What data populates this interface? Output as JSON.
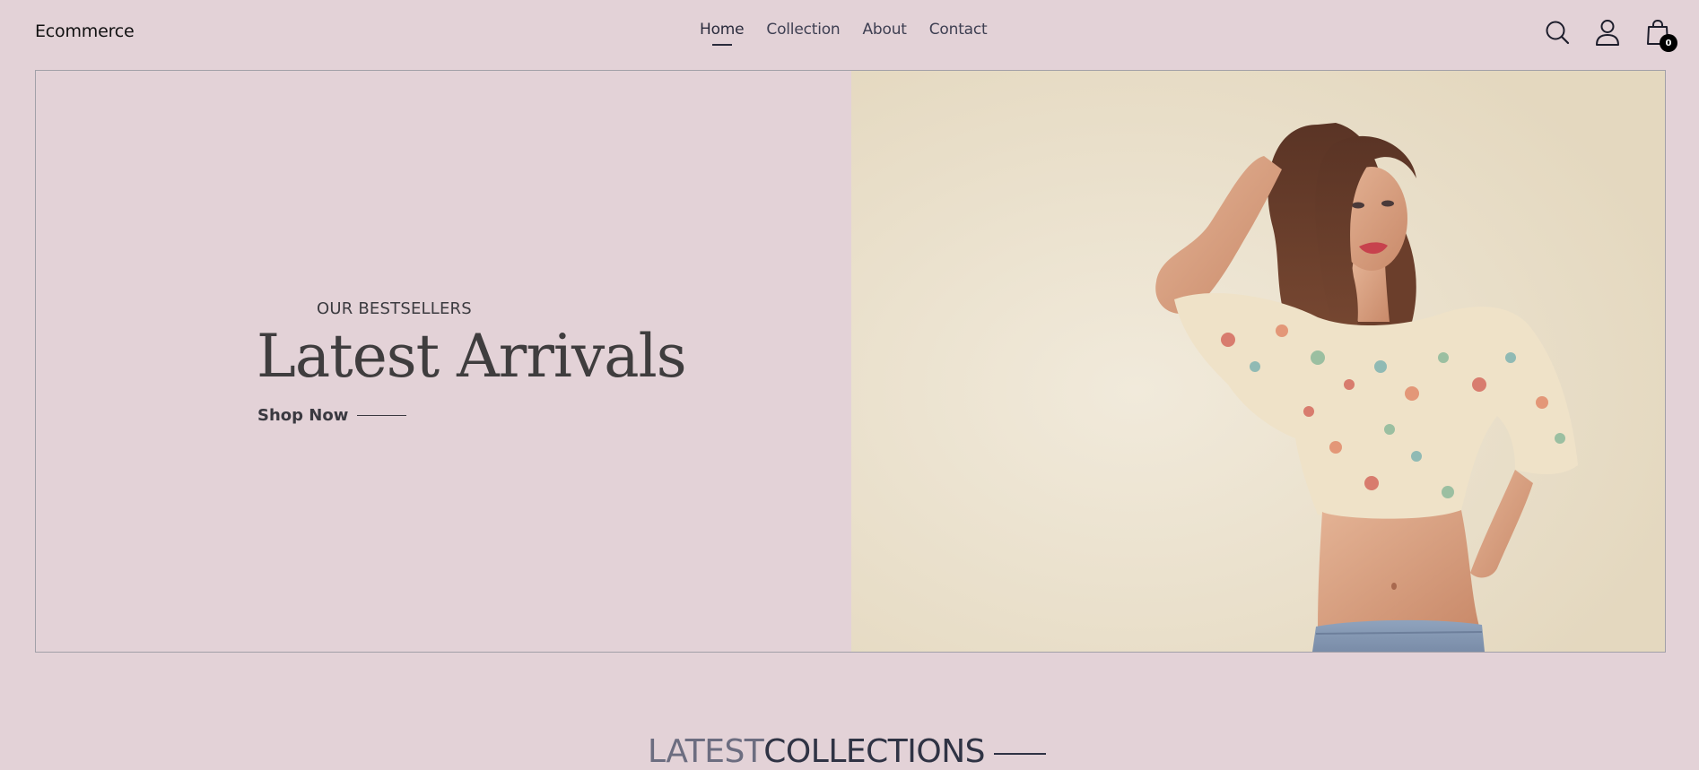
{
  "header": {
    "logo": "Ecommerce",
    "nav": [
      {
        "label": "Home",
        "active": true
      },
      {
        "label": "Collection",
        "active": false
      },
      {
        "label": "About",
        "active": false
      },
      {
        "label": "Contact",
        "active": false
      }
    ],
    "icons": [
      "search-icon",
      "user-icon",
      "cart-icon"
    ],
    "cart_count": "0"
  },
  "hero": {
    "subtitle": "OUR BESTSELLERS",
    "title": "Latest Arrivals",
    "cta_label": "Shop Now",
    "image": "model-photo"
  },
  "collections": {
    "title_light": "LATEST",
    "title_bold": "COLLECTIONS"
  },
  "colors": {
    "background": "#e3d2d7",
    "text_dark": "#2a2b3c",
    "badge": "#000000"
  }
}
